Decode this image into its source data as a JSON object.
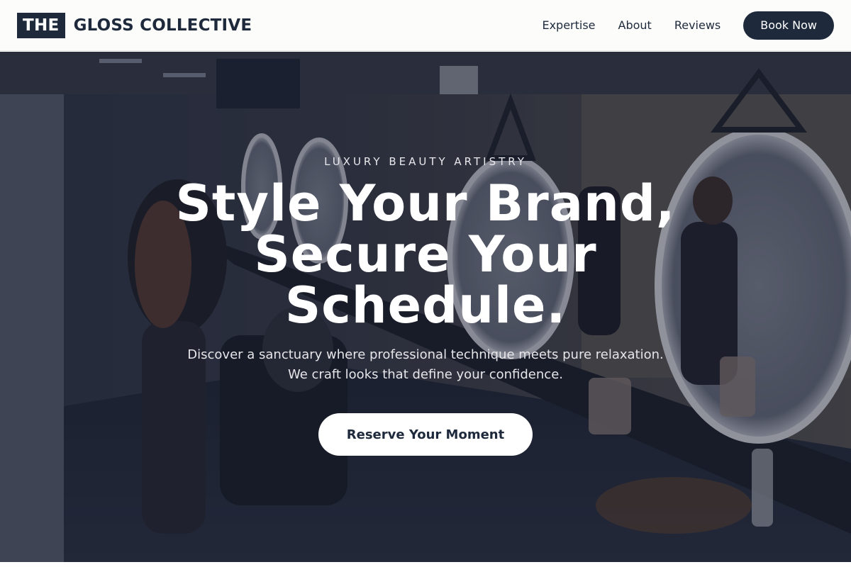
{
  "brand": {
    "badge": "THE",
    "name": "GLOSS COLLECTIVE"
  },
  "nav": {
    "items": [
      "Expertise",
      "About",
      "Reviews"
    ],
    "cta": "Book Now"
  },
  "hero": {
    "eyebrow": "LUXURY BEAUTY ARTISTRY",
    "headline": [
      "Style Your Brand,",
      "Secure Your",
      "Schedule."
    ],
    "subtext": [
      "Discover a sanctuary where professional technique meets pure relaxation.",
      "We craft looks that define your confidence."
    ],
    "cta": "Reserve Your Moment"
  },
  "colors": {
    "navy": "#1e2a3c",
    "header_bg": "#fcfcfa",
    "white": "#ffffff"
  }
}
